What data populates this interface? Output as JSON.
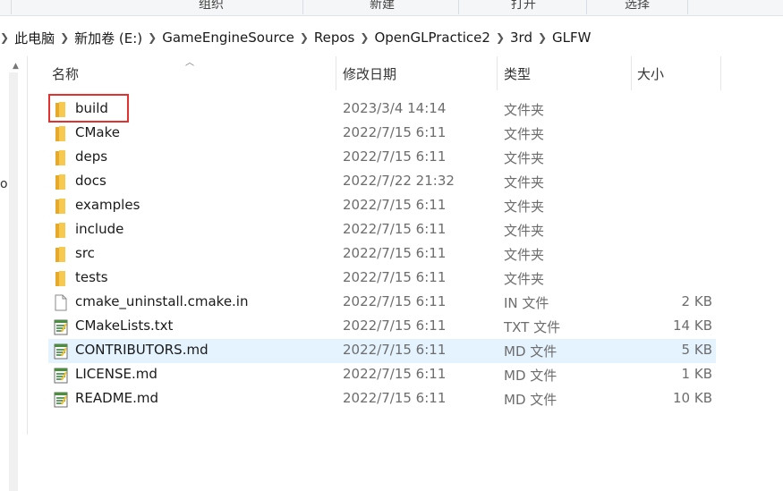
{
  "ribbon": {
    "groups": [
      "组织",
      "新建",
      "打开",
      "选择"
    ]
  },
  "breadcrumb": [
    "此电脑",
    "新加卷 (E:)",
    "GameEngineSource",
    "Repos",
    "OpenGLPractice2",
    "3rd",
    "GLFW"
  ],
  "nav_fragment": "o",
  "columns": {
    "name": "名称",
    "date": "修改日期",
    "type": "类型",
    "size": "大小"
  },
  "files": [
    {
      "name": "build",
      "date": "2023/3/4 14:14",
      "type": "文件夹",
      "size": "",
      "icon": "folder-icon"
    },
    {
      "name": "CMake",
      "date": "2022/7/15 6:11",
      "type": "文件夹",
      "size": "",
      "icon": "folder-icon"
    },
    {
      "name": "deps",
      "date": "2022/7/15 6:11",
      "type": "文件夹",
      "size": "",
      "icon": "folder-icon"
    },
    {
      "name": "docs",
      "date": "2022/7/22 21:32",
      "type": "文件夹",
      "size": "",
      "icon": "folder-icon"
    },
    {
      "name": "examples",
      "date": "2022/7/15 6:11",
      "type": "文件夹",
      "size": "",
      "icon": "folder-icon"
    },
    {
      "name": "include",
      "date": "2022/7/15 6:11",
      "type": "文件夹",
      "size": "",
      "icon": "folder-icon"
    },
    {
      "name": "src",
      "date": "2022/7/15 6:11",
      "type": "文件夹",
      "size": "",
      "icon": "folder-icon"
    },
    {
      "name": "tests",
      "date": "2022/7/15 6:11",
      "type": "文件夹",
      "size": "",
      "icon": "folder-icon"
    },
    {
      "name": "cmake_uninstall.cmake.in",
      "date": "2022/7/15 6:11",
      "type": "IN 文件",
      "size": "2 KB",
      "icon": "blank-file-icon"
    },
    {
      "name": "CMakeLists.txt",
      "date": "2022/7/15 6:11",
      "type": "TXT 文件",
      "size": "14 KB",
      "icon": "text-file-icon"
    },
    {
      "name": "CONTRIBUTORS.md",
      "date": "2022/7/15 6:11",
      "type": "MD 文件",
      "size": "5 KB",
      "icon": "text-file-icon"
    },
    {
      "name": "LICENSE.md",
      "date": "2022/7/15 6:11",
      "type": "MD 文件",
      "size": "1 KB",
      "icon": "text-file-icon"
    },
    {
      "name": "README.md",
      "date": "2022/7/15 6:11",
      "type": "MD 文件",
      "size": "10 KB",
      "icon": "text-file-icon"
    }
  ],
  "colors": {
    "hover_row": "#e5f3ff",
    "highlight_box": "#e53030",
    "folder": "#f8c94f"
  }
}
